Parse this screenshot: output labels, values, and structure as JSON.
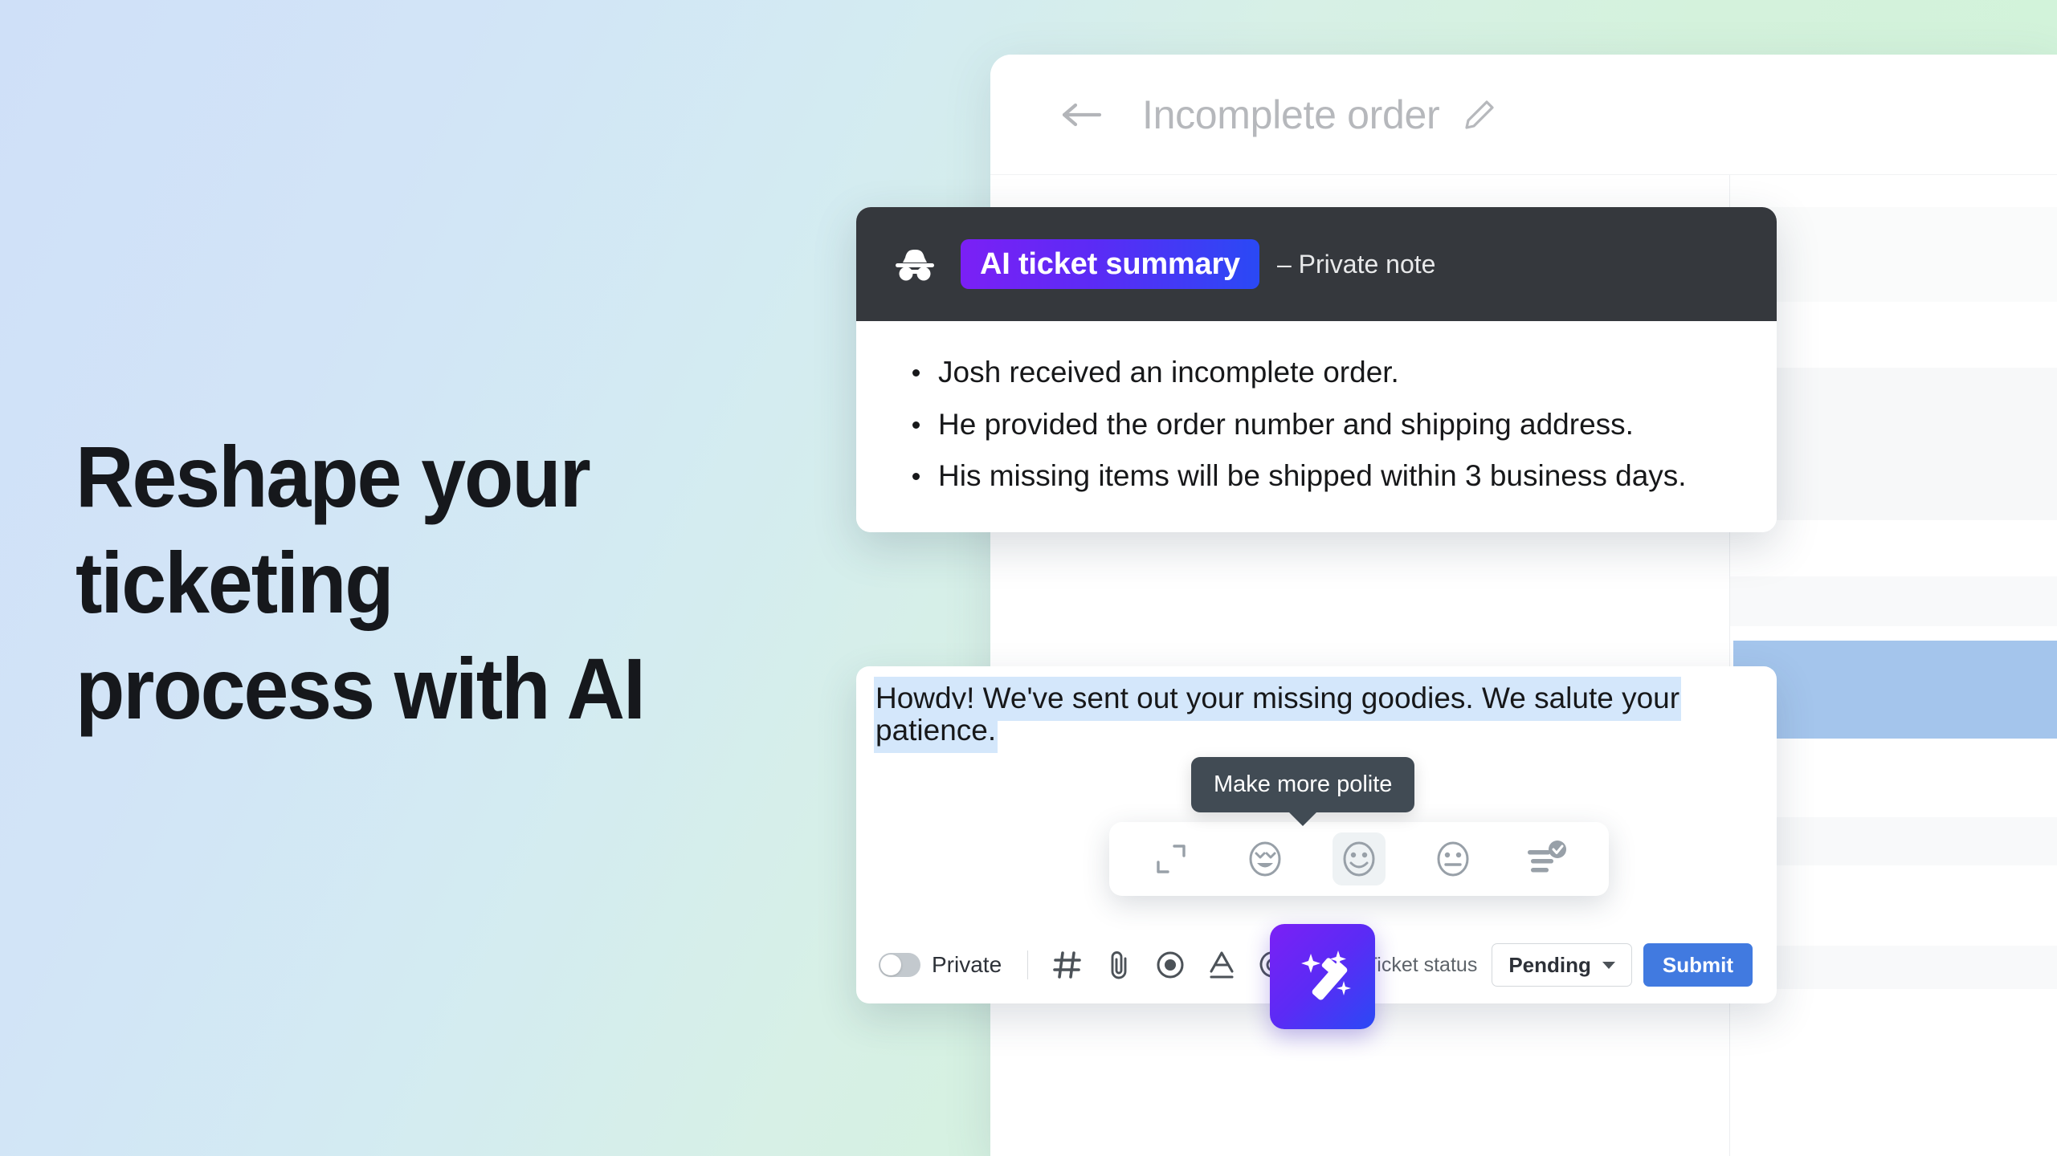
{
  "hero": {
    "heading": "Reshape your\nticketing\nprocess with AI"
  },
  "ticket": {
    "title": "Incomplete order",
    "back_icon": "back-arrow-icon",
    "edit_icon": "pencil-icon"
  },
  "ai_summary": {
    "icon": "incognito-icon",
    "badge_label": "AI ticket summary",
    "note_label": "– Private note",
    "bullets": [
      "Josh received an incomplete order.",
      "He provided the order number and shipping address.",
      "His missing items will be shipped within 3 business days."
    ]
  },
  "composer": {
    "message_text": "Howdy! We've sent out your missing goodies. We salute your patience.",
    "tooltip": "Make more polite",
    "tone_options": [
      {
        "name": "expand-icon",
        "label": "Expand"
      },
      {
        "name": "face-laughing-icon",
        "label": "Make friendlier"
      },
      {
        "name": "face-smiling-icon",
        "label": "Make more polite",
        "selected": true
      },
      {
        "name": "face-neutral-icon",
        "label": "Make more formal"
      },
      {
        "name": "grammar-check-icon",
        "label": "Fix spelling and grammar"
      }
    ],
    "toolbar": {
      "private_toggle_label": "Private",
      "private_toggle_on": false,
      "icons": [
        {
          "name": "hashtag-icon"
        },
        {
          "name": "attachment-icon"
        },
        {
          "name": "record-icon"
        },
        {
          "name": "text-format-icon"
        },
        {
          "name": "mention-icon"
        }
      ],
      "ticket_status_label": "Ticket status",
      "status_value": "Pending",
      "submit_label": "Submit"
    },
    "magic_wand_icon": "magic-wand-icon"
  },
  "colors": {
    "accent_purple": "#7b20f5",
    "accent_blue": "#2a49f5",
    "submit_blue": "#417ae0",
    "dark_header": "#35383d",
    "tooltip_bg": "#414b54",
    "highlight_blue": "#d4e7fb",
    "bg_gradient_start": "#cfe0f8",
    "bg_gradient_end": "#cdf0d8"
  }
}
